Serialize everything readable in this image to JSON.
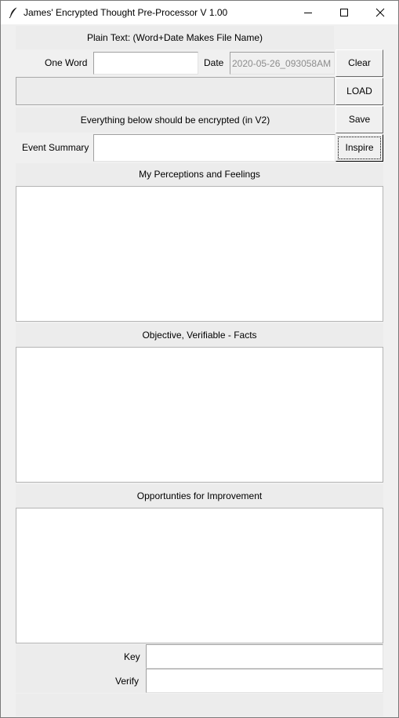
{
  "window": {
    "title": "James' Encrypted Thought Pre-Processor V 1.00"
  },
  "header": {
    "plain_text_label": "Plain Text: (Word+Date Makes File Name)"
  },
  "fields": {
    "one_word_label": "One Word",
    "one_word_value": "",
    "date_label": "Date",
    "date_value": "2020-05-26_093058AM",
    "event_summary_label": "Event Summary",
    "event_summary_value": "",
    "key_label": "Key",
    "key_value": "",
    "verify_label": "Verify",
    "verify_value": ""
  },
  "buttons": {
    "clear": "Clear",
    "load": "LOAD",
    "save": "Save",
    "inspire": "Inspire"
  },
  "sections": {
    "encrypted_notice": "Everything below should be encrypted (in V2)",
    "perceptions": "My Perceptions and Feelings",
    "facts": "Objective, Verifiable - Facts",
    "improvement": "Opportunties for Improvement"
  },
  "colors": {
    "titlebar": "#ffffff",
    "window_bg": "#f0f0f0",
    "label_bar": "#ececec"
  }
}
